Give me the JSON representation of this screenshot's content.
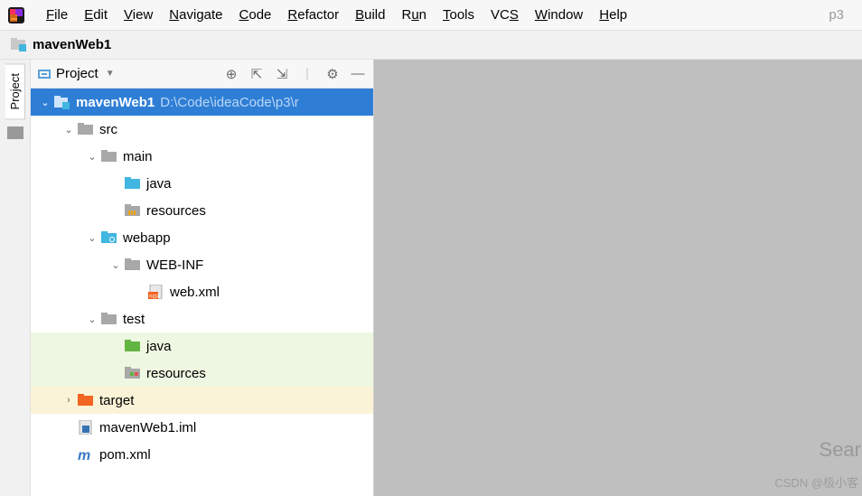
{
  "menu": {
    "items": [
      {
        "label": "File",
        "u": "F",
        "rest": "ile"
      },
      {
        "label": "Edit",
        "u": "E",
        "rest": "dit"
      },
      {
        "label": "View",
        "u": "V",
        "rest": "iew"
      },
      {
        "label": "Navigate",
        "u": "N",
        "rest": "avigate"
      },
      {
        "label": "Code",
        "u": "C",
        "rest": "ode"
      },
      {
        "label": "Refactor",
        "u": "R",
        "rest": "efactor"
      },
      {
        "label": "Build",
        "u": "B",
        "rest": "uild"
      },
      {
        "label": "Run",
        "u": "",
        "rest": "R",
        "u2": "u",
        "rest2": "n"
      },
      {
        "label": "Tools",
        "u": "T",
        "rest": "ools"
      },
      {
        "label": "VCS",
        "u": "",
        "rest": "VC",
        "u2": "S",
        "rest2": ""
      },
      {
        "label": "Window",
        "u": "W",
        "rest": "indow"
      },
      {
        "label": "Help",
        "u": "H",
        "rest": "elp"
      }
    ],
    "project_short": "p3"
  },
  "navbar": {
    "crumb": "mavenWeb1"
  },
  "sidebar": {
    "tab": "Project"
  },
  "panel": {
    "title": "Project"
  },
  "tree": {
    "root": {
      "name": "mavenWeb1",
      "path": "D:\\Code\\ideaCode\\p3\\r"
    },
    "rows": [
      {
        "indent": 0,
        "arrow": "down",
        "icon": "module",
        "label": "mavenWeb1",
        "hint": "D:\\Code\\ideaCode\\p3\\r",
        "selected": true
      },
      {
        "indent": 1,
        "arrow": "down",
        "icon": "folder-grey",
        "label": "src"
      },
      {
        "indent": 2,
        "arrow": "down",
        "icon": "folder-grey",
        "label": "main"
      },
      {
        "indent": 3,
        "arrow": "",
        "icon": "folder-blue",
        "label": "java"
      },
      {
        "indent": 3,
        "arrow": "",
        "icon": "folder-res",
        "label": "resources"
      },
      {
        "indent": 2,
        "arrow": "down",
        "icon": "folder-web",
        "label": "webapp"
      },
      {
        "indent": 3,
        "arrow": "down",
        "icon": "folder-grey",
        "label": "WEB-INF"
      },
      {
        "indent": 4,
        "arrow": "",
        "icon": "xml-web",
        "label": "web.xml"
      },
      {
        "indent": 2,
        "arrow": "down",
        "icon": "folder-grey",
        "label": "test"
      },
      {
        "indent": 3,
        "arrow": "",
        "icon": "folder-green",
        "label": "java",
        "green": true
      },
      {
        "indent": 3,
        "arrow": "",
        "icon": "folder-res-g",
        "label": "resources",
        "green": true
      },
      {
        "indent": 1,
        "arrow": "right",
        "icon": "folder-orange",
        "label": "target",
        "yellow": true
      },
      {
        "indent": 1,
        "arrow": "",
        "icon": "iml",
        "label": "mavenWeb1.iml"
      },
      {
        "indent": 1,
        "arrow": "",
        "icon": "maven",
        "label": "pom.xml"
      }
    ]
  },
  "editor": {
    "search_hint": "Searc",
    "watermark": "CSDN @极小客"
  }
}
